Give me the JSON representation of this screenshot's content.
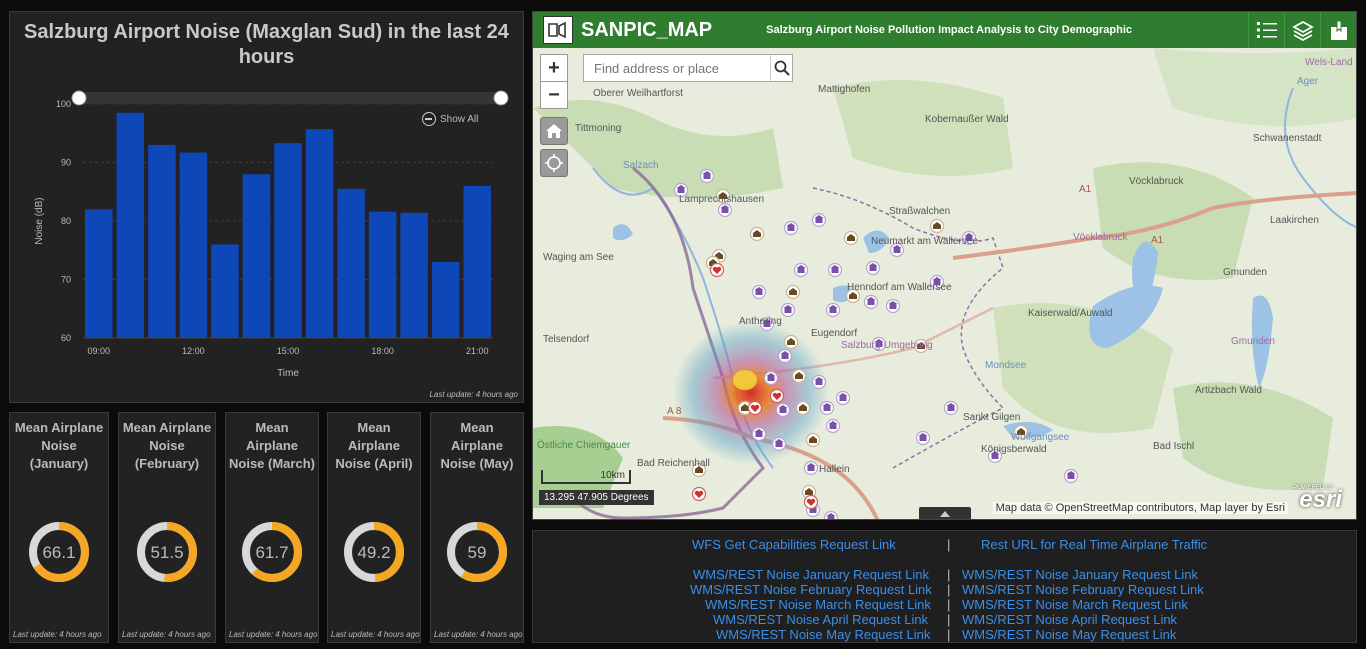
{
  "chart": {
    "title": "Salzburg Airport Noise (Maxglan Sud) in the last 24 hours",
    "show_all": "Show All",
    "last_update": "Last update: 4 hours ago",
    "colors": {
      "bar": "#0d47b8",
      "panel": "#222222"
    }
  },
  "chart_data": {
    "type": "bar",
    "title": "Salzburg Airport Noise (Maxglan Sud) in the last 24 hours",
    "xlabel": "Time",
    "ylabel": "Noise (dB)",
    "ylim": [
      60,
      100
    ],
    "yticks": [
      60,
      70,
      80,
      90,
      100
    ],
    "xticks": [
      "09:00",
      "12:00",
      "15:00",
      "18:00",
      "21:00"
    ],
    "xtick_bar_index": [
      0,
      3,
      6,
      9,
      12
    ],
    "values": [
      82,
      98.5,
      93,
      91.7,
      76,
      88,
      93.3,
      95.7,
      85.5,
      81.6,
      81.4,
      73,
      86
    ]
  },
  "gauges": [
    {
      "title": "Mean Airplane Noise (January)",
      "value": 66.1,
      "max": 100,
      "last_update": "Last update: 4 hours ago"
    },
    {
      "title": "Mean Airplane Noise (February)",
      "value": 51.5,
      "max": 100,
      "last_update": "Last update: 4 hours ago"
    },
    {
      "title": "Mean Airplane Noise (March)",
      "value": 61.7,
      "max": 100,
      "last_update": "Last update: 4 hours ago"
    },
    {
      "title": "Mean Airplane Noise (April)",
      "value": 49.2,
      "max": 100,
      "last_update": "Last update: 4 hours ago"
    },
    {
      "title": "Mean Airplane Noise (May)",
      "value": 59,
      "max": 100,
      "last_update": "Last update: 4 hours ago"
    }
  ],
  "gauge_colors": {
    "fill": "#f5a623",
    "track": "#d8d8d8"
  },
  "map": {
    "app_title": "SANPIC_MAP",
    "subtitle": "Salzburg Airport Noise Pollution Impact Analysis to City Demographic",
    "search_placeholder": "Find address or place",
    "coordinates": "13.295 47.905 Degrees",
    "scale_label": "10km",
    "attribution": "Map data © OpenStreetMap contributors, Map layer by Esri",
    "esri_powered": "POWERED BY",
    "esri_logo": "esri",
    "place_labels": [
      "Mattighofen",
      "Vöcklabruck",
      "Laakirchen",
      "Schwanenstadt",
      "Gmunden",
      "Waging am See",
      "Tittmoning",
      "Salzach",
      "Kobernaußer Wald",
      "Kaiserwald/Auwald",
      "Mondsee",
      "Telsendorf",
      "Östliche Chiemgauer",
      "Bad Reichenhall",
      "Hallein",
      "Königsberwald",
      "Bad Ischl",
      "Artizbach Wald",
      "Oberer Weilhartforst",
      "Ager",
      "Wels-Land",
      "Vöcklabruck",
      "Gmunden",
      "Anthering",
      "Eugendorf",
      "Wolfgangsee",
      "Sankt Gilgen",
      "Neumarkt am Wallersee",
      "Henndorf am Wallersee",
      "Straßwalchen",
      "Salzburg-Umgebung",
      "A 8",
      "A1",
      "A1",
      "Lamprechtshausen"
    ],
    "colors": {
      "header": "#2f7d2f",
      "lake": "#9cc3e6",
      "forest": "#c6dbb0",
      "highway": "#d9a18b"
    }
  },
  "links": {
    "wfs": "WFS Get Capabilities Request Link",
    "rest_traffic": "Rest URL for Real Time Airplane Traffic",
    "left": [
      "WMS/REST Noise January Request Link",
      "WMS/REST Noise February Request Link",
      "WMS/REST Noise March Request Link",
      "WMS/REST Noise April Request Link",
      "WMS/REST Noise May Request Link"
    ],
    "right": [
      "WMS/REST Noise January Request Link",
      "WMS/REST Noise February Request Link",
      "WMS/REST Noise March Request Link",
      "WMS/REST Noise April Request Link",
      "WMS/REST Noise May Request Link"
    ],
    "separator": "|",
    "color": "#3d8ee8"
  }
}
